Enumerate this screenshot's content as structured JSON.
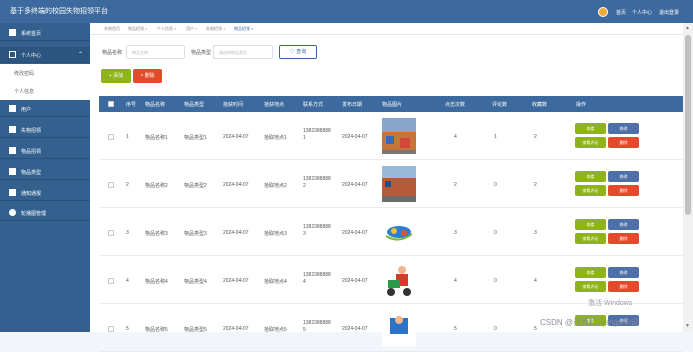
{
  "header": {
    "title": "基于多终端的校园失物招领平台",
    "nav": [
      "首页",
      "个人中心",
      "退出登录"
    ]
  },
  "sidebar": {
    "items": [
      {
        "label": "系统首页",
        "icon": "home-icon"
      },
      {
        "label": "个人中心",
        "icon": "user-icon",
        "open": true,
        "sub": [
          "修改密码",
          "个人信息"
        ]
      },
      {
        "label": "用户",
        "icon": "users-icon"
      },
      {
        "label": "失物招领",
        "icon": "grid-icon"
      },
      {
        "label": "物品招领",
        "icon": "grid-icon"
      },
      {
        "label": "物品类型",
        "icon": "chat-icon"
      },
      {
        "label": "通知通报",
        "icon": "grid-icon"
      },
      {
        "label": "轮播图管理",
        "icon": "pin-icon"
      }
    ]
  },
  "breadcrumb": [
    "系统首页",
    "物品招领 ×",
    "个人信息 ×",
    "用户 ×",
    "失物招领 ×",
    "物品招领 ×"
  ],
  "search": {
    "name_label": "物品名称",
    "name_placeholder": "物品名称",
    "type_label": "物品类型",
    "type_placeholder": "请选择物品类型",
    "button": "查询"
  },
  "toolbar": {
    "add": "添加",
    "delete": "删除"
  },
  "table": {
    "headers": [
      "序号",
      "物品名称",
      "物品类型",
      "拾获时间",
      "拾获地点",
      "联系方式",
      "发布日期",
      "物品图片",
      "点击次数",
      "评论数",
      "收藏数",
      "操作"
    ],
    "rows": [
      {
        "no": "1",
        "name": "物品名称1",
        "type": "物品类型1",
        "time": "2024-04-07",
        "place": "拾取地点1",
        "phone": "13823888881",
        "date": "2024-04-07",
        "clicks": "4",
        "comments": "1",
        "favs": "2"
      },
      {
        "no": "2",
        "name": "物品名称2",
        "type": "物品类型2",
        "time": "2024-04-07",
        "place": "拾取地点2",
        "phone": "13823888882",
        "date": "2024-04-07",
        "clicks": "2",
        "comments": "0",
        "favs": "2"
      },
      {
        "no": "3",
        "name": "物品名称3",
        "type": "物品类型3",
        "time": "2024-04-07",
        "place": "拾取地点3",
        "phone": "13823888883",
        "date": "2024-04-07",
        "clicks": "3",
        "comments": "0",
        "favs": "3"
      },
      {
        "no": "4",
        "name": "物品名称4",
        "type": "物品类型4",
        "time": "2024-04-07",
        "place": "拾取地点4",
        "phone": "13823888884",
        "date": "2024-04-07",
        "clicks": "4",
        "comments": "0",
        "favs": "4"
      },
      {
        "no": "5",
        "name": "物品名称5",
        "type": "物品类型5",
        "time": "2024-04-07",
        "place": "拾取地点5",
        "phone": "13823888885",
        "date": "2024-04-07",
        "clicks": "5",
        "comments": "0",
        "favs": "5"
      }
    ],
    "actions": {
      "view": "查看",
      "edit": "修改",
      "review": "查看评论",
      "delete": "删除"
    }
  },
  "overlay": {
    "windows": "激活 Windows",
    "csdn": "CSDN @计算机Django毕设"
  },
  "colors": {
    "header": "#3d6a9e",
    "sidebar": "#33608f",
    "green": "#8fb31a",
    "red": "#e44a2a",
    "blue": "#4f6fa8"
  }
}
